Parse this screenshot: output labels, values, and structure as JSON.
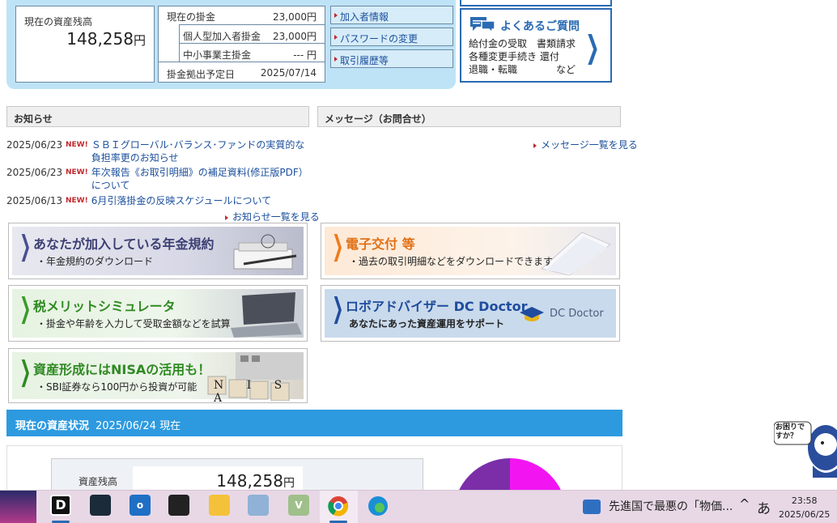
{
  "summary": {
    "asset_label": "現在の資産残高",
    "asset_value": "148,258",
    "asset_unit": "円",
    "current_contrib_label": "現在の掛金",
    "current_contrib_value": "23,000円",
    "individual_label": "個人型加入者掛金",
    "individual_value": "23,000円",
    "employer_label": "中小事業主掛金",
    "employer_value": "--- 円",
    "schedule_label": "掛金拠出予定日",
    "schedule_value": "2025/07/14"
  },
  "quick_links": [
    "加入者情報",
    "パスワードの変更",
    "取引履歴等"
  ],
  "faq": {
    "title": "よくあるご質問",
    "line1": "給付金の受取　書類請求",
    "line2": "各種変更手続き 還付",
    "line3": "退職・転職　　　　など"
  },
  "notice": {
    "header": "お知らせ",
    "items": [
      {
        "date": "2025/06/23",
        "badge": "NEW!",
        "text": "ＳＢＩグローバル･バランス･ファンドの実質的な負担率更のお知らせ"
      },
      {
        "date": "2025/06/23",
        "badge": "NEW!",
        "text": "年次報告《お取引明細》の補足資料(修正版PDF）について"
      },
      {
        "date": "2025/06/13",
        "badge": "NEW!",
        "text": "6月引落掛金の反映スケジュールについて"
      }
    ],
    "more": "お知らせ一覧を見る"
  },
  "message": {
    "header": "メッセージ（お問合せ）",
    "more": "メッセージ一覧を見る"
  },
  "banners": {
    "pension": {
      "title": "あなたが加入している年金規約",
      "sub": "・年金規約のダウンロード"
    },
    "edelivery": {
      "title": "電子交付 等",
      "sub": "・過去の取引明細などをダウンロードできます"
    },
    "tax": {
      "title": "税メリットシミュレータ",
      "sub": "・掛金や年齢を入力して受取金額などを試算"
    },
    "robo": {
      "title": "ロボアドバイザー DC Doctor",
      "sub": "あなたにあった資産運用をサポート",
      "logo": "DC Doctor"
    },
    "nisa": {
      "title": "資産形成にはNISAの活用も！",
      "sub": "・SBI証券なら100円から投資が可能",
      "tiles": "N I S A"
    }
  },
  "status": {
    "title": "現在の資産状況",
    "date": "2025/06/24 現在",
    "balance_label": "資産残高",
    "balance_value": "148,258",
    "balance_unit": "円"
  },
  "mascot": {
    "bubble": "お困りですか？"
  },
  "taskbar": {
    "news": "先進国で最悪の「物価...",
    "ime": "あ",
    "time": "23:58",
    "date": "2025/06/25"
  },
  "colors": {
    "accent": "#2d9ae0",
    "link": "#1b4f9c",
    "new_badge": "#c0282d",
    "faq_blue": "#2a6bb3"
  }
}
